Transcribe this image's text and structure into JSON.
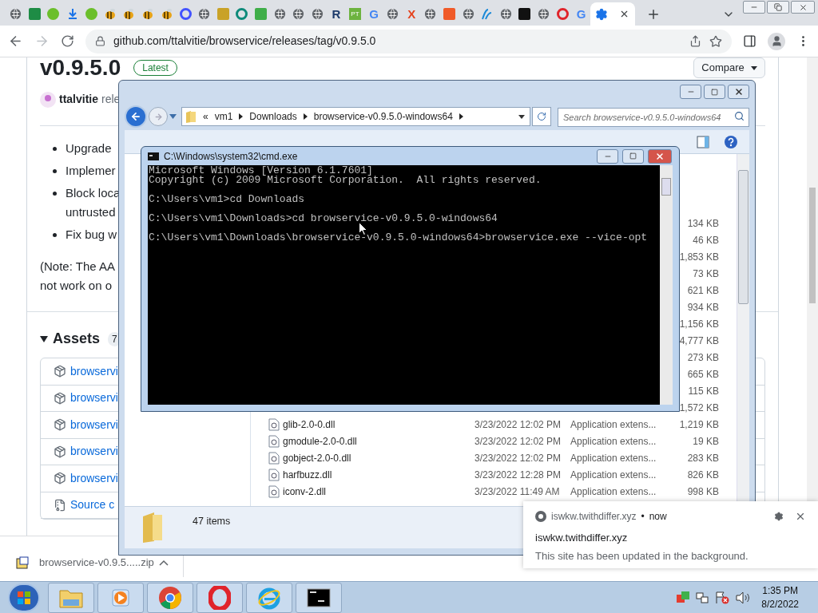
{
  "browser": {
    "tabs": [
      {
        "kind": "globe",
        "selected": false
      },
      {
        "kind": "square",
        "color": "#1e8c45",
        "selected": false
      },
      {
        "kind": "circle",
        "color": "#6bbf2b",
        "selected": false
      },
      {
        "kind": "download",
        "color": "#1a73e8",
        "selected": false
      },
      {
        "kind": "circle",
        "color": "#6bbf2b",
        "selected": false
      },
      {
        "kind": "bee",
        "selected": false
      },
      {
        "kind": "bee",
        "selected": false
      },
      {
        "kind": "bee",
        "selected": false
      },
      {
        "kind": "bee",
        "selected": false
      },
      {
        "kind": "ring",
        "color": "#4353ff",
        "selected": false
      },
      {
        "kind": "globe",
        "selected": false
      },
      {
        "kind": "square",
        "color": "#c9a227",
        "selected": false
      },
      {
        "kind": "ring",
        "color": "#0e8a7a",
        "selected": false
      },
      {
        "kind": "square",
        "color": "#3fae49",
        "selected": false
      },
      {
        "kind": "globe",
        "selected": false
      },
      {
        "kind": "globe",
        "selected": false
      },
      {
        "kind": "globe",
        "selected": false
      },
      {
        "kind": "letter",
        "text": "R",
        "color": "#1d3b6b",
        "selected": false
      },
      {
        "kind": "badge",
        "text": "PT",
        "color": "#6db33f",
        "selected": false
      },
      {
        "kind": "letter",
        "text": "G",
        "color": "#4285f4",
        "selected": false
      },
      {
        "kind": "globe",
        "selected": false
      },
      {
        "kind": "letter",
        "text": "X",
        "color": "#e5421d",
        "selected": false
      },
      {
        "kind": "globe",
        "selected": false
      },
      {
        "kind": "square",
        "color": "#f05a28",
        "selected": false
      },
      {
        "kind": "globe",
        "selected": false
      },
      {
        "kind": "squiggle",
        "color": "#1c8ad8",
        "selected": false
      },
      {
        "kind": "globe",
        "selected": false
      },
      {
        "kind": "square",
        "color": "#111111",
        "selected": false
      },
      {
        "kind": "globe",
        "selected": false
      },
      {
        "kind": "ring",
        "color": "#e0242b",
        "selected": false
      },
      {
        "kind": "letter",
        "text": "G",
        "color": "#4285f4",
        "selected": false
      },
      {
        "kind": "gear",
        "color": "#1a73e8",
        "selected": true
      }
    ],
    "url": "github.com/ttalvitie/browservice/releases/tag/v0.9.5.0"
  },
  "release": {
    "version": "v0.9.5.0",
    "badge": "Latest",
    "compare": "Compare",
    "author": "ttalvitie",
    "author_rest": "rele",
    "bullets": [
      "Upgrade",
      "Implemer",
      "Block loca\nuntrusted",
      "Fix bug w"
    ],
    "note": "(Note: The AA\nnot work on o",
    "assets_title": "Assets",
    "assets_count": "7",
    "assets": [
      {
        "kind": "package",
        "name": "browservi"
      },
      {
        "kind": "package",
        "name": "browservi"
      },
      {
        "kind": "package",
        "name": "browservi"
      },
      {
        "kind": "package",
        "name": "browservi"
      },
      {
        "kind": "package",
        "name": "browservi"
      },
      {
        "kind": "source",
        "name": "Source c"
      }
    ]
  },
  "download": {
    "file": "browservice-v0.9.5.....zip"
  },
  "explorer": {
    "overflow": "«",
    "path": [
      "vm1",
      "Downloads",
      "browservice-v0.9.5.0-windows64"
    ],
    "search_placeholder": "Search browservice-v0.9.5.0-windows64",
    "files": [
      {
        "size": "134 KB"
      },
      {
        "size": "46 KB"
      },
      {
        "size": "1,853 KB"
      },
      {
        "size": "73 KB"
      },
      {
        "size": "621 KB"
      },
      {
        "size": "934 KB"
      },
      {
        "size": "1,156 KB"
      },
      {
        "size": "4,777 KB"
      },
      {
        "size": "273 KB"
      },
      {
        "size": "665 KB"
      },
      {
        "size": "115 KB"
      },
      {
        "size": "1,572 KB"
      },
      {
        "name": "glib-2.0-0.dll",
        "date": "3/23/2022 12:02 PM",
        "type": "Application extens...",
        "size": "1,219 KB"
      },
      {
        "name": "gmodule-2.0-0.dll",
        "date": "3/23/2022 12:02 PM",
        "type": "Application extens...",
        "size": "19 KB"
      },
      {
        "name": "gobject-2.0-0.dll",
        "date": "3/23/2022 12:02 PM",
        "type": "Application extens...",
        "size": "283 KB"
      },
      {
        "name": "harfbuzz.dll",
        "date": "3/23/2022 12:28 PM",
        "type": "Application extens...",
        "size": "826 KB"
      },
      {
        "name": "iconv-2.dll",
        "date": "3/23/2022 11:49 AM",
        "type": "Application extens...",
        "size": "998 KB"
      }
    ],
    "status": "47 items"
  },
  "cmd": {
    "title": "C:\\Windows\\system32\\cmd.exe",
    "blocks": [
      [
        "Microsoft Windows [Version 6.1.7601]",
        "Copyright (c) 2009 Microsoft Corporation.  All rights reserved."
      ],
      [
        "C:\\Users\\vm1>cd Downloads"
      ],
      [
        "C:\\Users\\vm1\\Downloads>cd browservice-v0.9.5.0-windows64"
      ],
      [
        "C:\\Users\\vm1\\Downloads\\browservice-v0.9.5.0-windows64>browservice.exe --vice-opt"
      ]
    ]
  },
  "notification": {
    "source": "iswkw.twithdiffer.xyz",
    "separator": "•",
    "time": "now",
    "title": "iswkw.twithdiffer.xyz",
    "body": "This site has been updated in the background."
  },
  "taskbar": {
    "apps": [
      {
        "kind": "explorer"
      },
      {
        "kind": "media"
      },
      {
        "kind": "chrome"
      },
      {
        "kind": "opera"
      },
      {
        "kind": "ie"
      },
      {
        "kind": "cmd"
      }
    ],
    "time": "1:35 PM",
    "date": "8/2/2022"
  }
}
